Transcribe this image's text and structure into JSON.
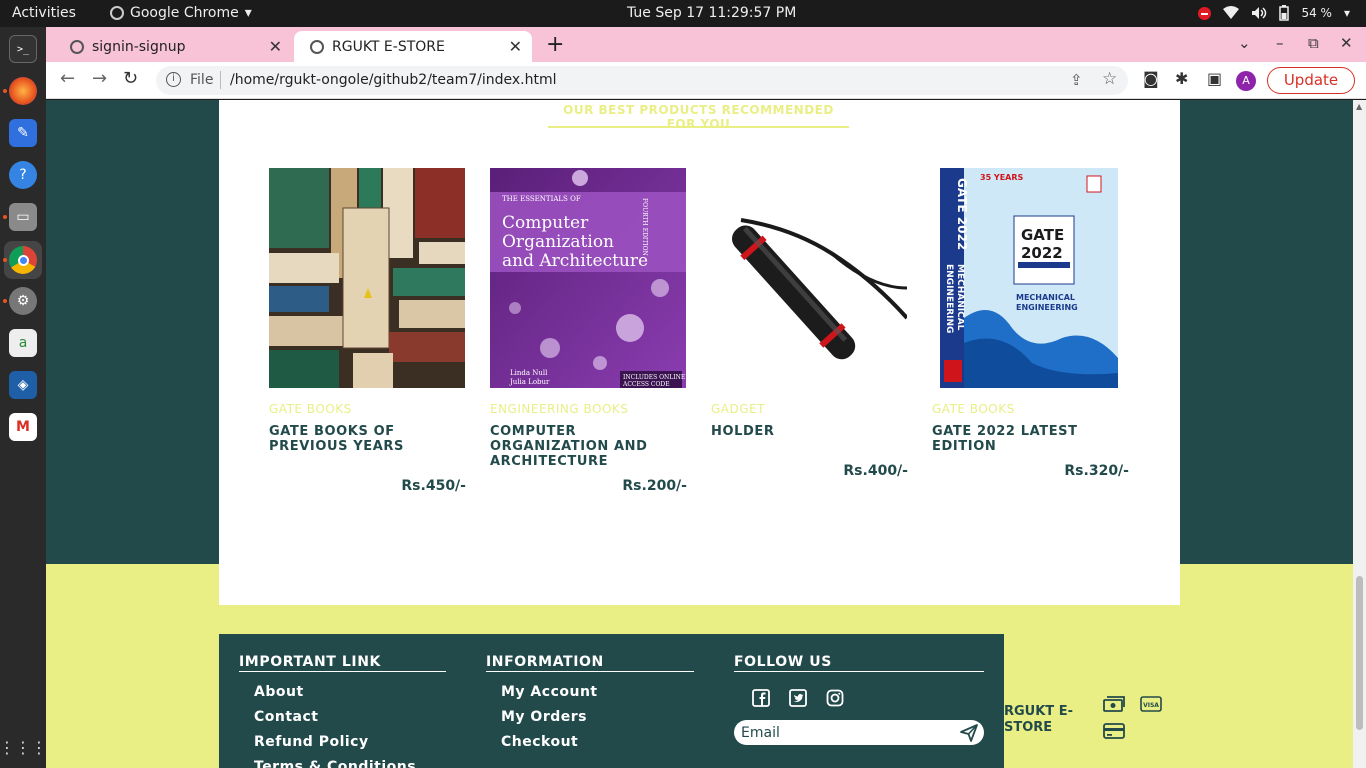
{
  "system": {
    "activities": "Activities",
    "app_name": "Google Chrome",
    "clock": "Tue Sep 17  11:29:57 PM",
    "battery": "54 %"
  },
  "browser": {
    "tabs": [
      {
        "title": "signin-signup",
        "active": false
      },
      {
        "title": "RGUKT E-STORE",
        "active": true
      }
    ],
    "url_scheme": "File",
    "url": "/home/rgukt-ongole/github2/team7/index.html",
    "profile_initial": "A",
    "update_label": "Update"
  },
  "products_section": {
    "title": "OUR BEST PRODUCTS RECOMMENDED FOR YOU",
    "items": [
      {
        "category": "GATE BOOKS",
        "name": "GATE BOOKS OF PREVIOUS YEARS",
        "price": "Rs.450/-",
        "image": "stack-of-books"
      },
      {
        "category": "ENGINEERING BOOKS",
        "name": "COMPUTER ORGANIZATION AND ARCHITECTURE",
        "price": "Rs.200/-",
        "image": "coa-book-cover",
        "cover": {
          "series": "THE ESSENTIALS OF",
          "title_lines": [
            "Computer",
            "Organization",
            "and Architecture"
          ],
          "edition": "FOURTH EDITION",
          "authors": [
            "Linda Null",
            "Julia Lobur"
          ],
          "badge_lines": [
            "INCLUDES ONLINE",
            "ACCESS CODE"
          ]
        }
      },
      {
        "category": "GADGET",
        "name": "HOLDER",
        "price": "Rs.400/-",
        "image": "drawing-tube-holder"
      },
      {
        "category": "GATE BOOKS",
        "name": "GATE 2022 LATEST EDITION",
        "price": "Rs.320/-",
        "image": "gate-2022-cover",
        "cover": {
          "spine_lines": [
            "GATE 2022",
            "MECHANICAL",
            "ENGINEERING"
          ],
          "years": "35 YEARS",
          "big": "GATE",
          "year": "2022",
          "subject_lines": [
            "MECHANICAL",
            "ENGINEERING"
          ]
        }
      }
    ]
  },
  "footer": {
    "important_links": {
      "heading": "IMPORTANT LINK",
      "links": [
        "About",
        "Contact",
        "Refund Policy",
        "Terms & Conditions"
      ]
    },
    "information": {
      "heading": "INFORMATION",
      "links": [
        "My Account",
        "My Orders",
        "Checkout"
      ]
    },
    "follow_us": {
      "heading": "FOLLOW US",
      "social": [
        "facebook-icon",
        "twitter-icon",
        "instagram-icon"
      ],
      "email_placeholder": "Email"
    },
    "brand": "RGUKT E-STORE",
    "payment_icons": [
      "cash-icon",
      "visa-icon",
      "card-icon"
    ],
    "visa_text": "VISA"
  },
  "colors": {
    "teal": "#234a4b",
    "lime": "#e9ef85",
    "tab_strip": "#f8c3d6"
  }
}
